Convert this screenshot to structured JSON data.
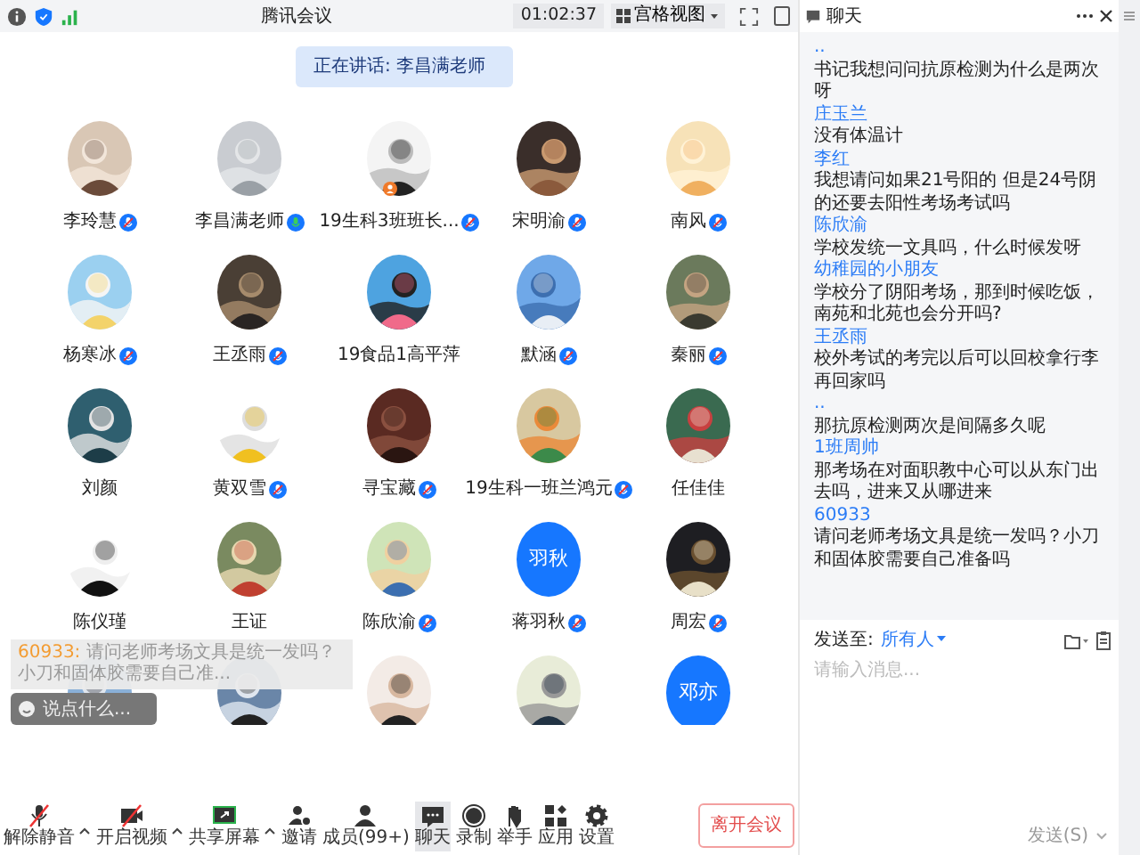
{
  "window": {
    "title": "腾讯会议"
  },
  "top_bar": {
    "timer": "01:02:37",
    "view_button": "宫格视图"
  },
  "speaking_banner": "正在讲话: 李昌满老师",
  "participants": [
    {
      "name": "李玲慧",
      "kind": "picture",
      "mic_muted": true,
      "host": false
    },
    {
      "name": "李昌满老师",
      "kind": "picture",
      "mic_muted": false,
      "host": false
    },
    {
      "name": "19生科3班班长...",
      "kind": "picture",
      "mic_muted": true,
      "host": true
    },
    {
      "name": "宋明渝",
      "kind": "picture",
      "mic_muted": true,
      "host": false
    },
    {
      "name": "南风",
      "kind": "picture",
      "mic_muted": true,
      "host": false
    },
    {
      "name": "杨寒冰",
      "kind": "picture",
      "mic_muted": true,
      "host": false
    },
    {
      "name": "王丞雨",
      "kind": "picture",
      "mic_muted": true,
      "host": false
    },
    {
      "name": "19食品1高平萍",
      "kind": "picture",
      "host": false
    },
    {
      "name": "默涵",
      "kind": "picture",
      "mic_muted": true,
      "host": false
    },
    {
      "name": "秦丽",
      "kind": "picture",
      "mic_muted": true,
      "host": false
    },
    {
      "name": "刘颜",
      "kind": "picture",
      "host": false
    },
    {
      "name": "黄双雪",
      "kind": "picture",
      "mic_muted": true,
      "host": false
    },
    {
      "name": "寻宝藏",
      "kind": "picture",
      "mic_muted": true,
      "host": false
    },
    {
      "name": "19生科一班兰鸿元",
      "kind": "picture",
      "mic_muted": true,
      "host": false
    },
    {
      "name": "任佳佳",
      "kind": "picture",
      "host": false
    },
    {
      "name": "陈仪瑾",
      "kind": "picture",
      "host": false
    },
    {
      "name": "王证",
      "kind": "picture",
      "host": false
    },
    {
      "name": "陈欣渝",
      "kind": "picture",
      "mic_muted": true,
      "host": false
    },
    {
      "name": "蒋羽秋",
      "kind": "text",
      "avatar_text": "羽秋",
      "mic_muted": true,
      "host": false
    },
    {
      "name": "周宏",
      "kind": "picture",
      "mic_muted": true,
      "host": false
    },
    {
      "kind": "picture",
      "host": false
    },
    {
      "kind": "picture",
      "host": false
    },
    {
      "kind": "picture",
      "host": false
    },
    {
      "kind": "picture",
      "host": false
    },
    {
      "kind": "text",
      "avatar_text": "邓亦",
      "host": false
    }
  ],
  "chat_overlay": {
    "sender": "60933:",
    "text": "请问老师考场文具是统一发吗？小刀和固体胶需要自己准...",
    "placeholder": "说点什么..."
  },
  "toolbar": [
    {
      "kind": "mic",
      "label": "解除静音",
      "off": true,
      "has_menu": true,
      "selected": false
    },
    {
      "kind": "video",
      "label": "开启视频",
      "off": true,
      "has_menu": true,
      "selected": false
    },
    {
      "kind": "share",
      "label": "共享屏幕",
      "off": false,
      "has_menu": true,
      "selected": false
    },
    {
      "kind": "invite",
      "label": "邀请",
      "off": false,
      "has_menu": false,
      "selected": false
    },
    {
      "kind": "members",
      "label": "成员(99+)",
      "off": false,
      "has_menu": false,
      "selected": false
    },
    {
      "kind": "chat",
      "label": "聊天",
      "off": false,
      "has_menu": false,
      "selected": true
    },
    {
      "kind": "record",
      "label": "录制",
      "off": false,
      "has_menu": false,
      "selected": false
    },
    {
      "kind": "hand",
      "label": "举手",
      "off": false,
      "has_menu": false,
      "selected": false
    },
    {
      "kind": "apps",
      "label": "应用",
      "off": false,
      "has_menu": false,
      "selected": false
    },
    {
      "kind": "settings",
      "label": "设置",
      "off": false,
      "has_menu": false,
      "selected": false
    }
  ],
  "leave_button": "离开会议",
  "chat": {
    "title": "聊天",
    "messages": [
      {
        "sender": "..",
        "text": "书记我想问问抗原检测为什么是两次呀"
      },
      {
        "sender": "庄玉兰",
        "text": "没有体温计"
      },
      {
        "sender": "李红",
        "text": "我想请问如果21号阳的  但是24号阴的还要去阳性考场考试吗"
      },
      {
        "sender": "陈欣渝",
        "text": "学校发统一文具吗，什么时候发呀"
      },
      {
        "sender": "幼稚园的小朋友",
        "text": "学校分了阴阳考场，那到时候吃饭，南苑和北苑也会分开吗?"
      },
      {
        "sender": "王丞雨",
        "text": "校外考试的考完以后可以回校拿行李再回家吗"
      },
      {
        "sender": "..",
        "text": "那抗原检测两次是间隔多久呢"
      },
      {
        "sender": "1班周帅",
        "text": "那考场在对面职教中心可以从东门出去吗，进来又从哪进来"
      },
      {
        "sender": "60933",
        "text": "请问老师考场文具是统一发吗？小刀和固体胶需要自己准备吗"
      }
    ],
    "send_to_label": "发送至:",
    "recipient": "所有人",
    "placeholder": "请输入消息...",
    "send_button": "发送(S)"
  }
}
